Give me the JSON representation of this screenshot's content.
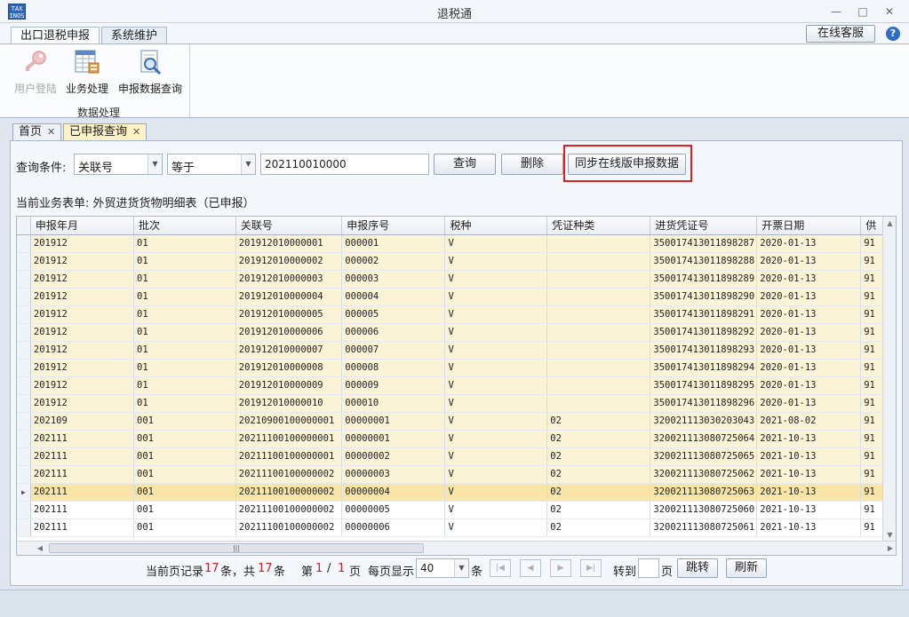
{
  "window": {
    "title": "退税通",
    "icon_text": "TAX\nINOS",
    "min": "—",
    "max": "□",
    "close": "✕"
  },
  "ribbon_tabs": [
    {
      "label": "出口退税申报"
    },
    {
      "label": "系统维护"
    }
  ],
  "support_label": "在线客服",
  "help_label": "?",
  "ribbon": {
    "buttons": [
      {
        "label": "用户登陆"
      },
      {
        "label": "业务处理"
      },
      {
        "label": "申报数据查询"
      }
    ],
    "group_label": "数据处理"
  },
  "doc_tabs": [
    {
      "label": "首页",
      "close": "✕"
    },
    {
      "label": "已申报查询",
      "close": "✕"
    }
  ],
  "query": {
    "label": "查询条件:",
    "field": "关联号",
    "operator": "等于",
    "value": "202110010000",
    "search_btn": "查询",
    "delete_btn": "删除",
    "sync_btn": "同步在线版申报数据"
  },
  "current_table_text": "当前业务表单: 外贸进货货物明细表（已申报）",
  "grid": {
    "columns": [
      "申报年月",
      "批次",
      "关联号",
      "申报序号",
      "税种",
      "凭证种类",
      "进货凭证号",
      "开票日期",
      "供"
    ],
    "rows": [
      [
        "201912",
        "01",
        "201912010000001",
        "000001",
        "V",
        "",
        "35001741301189828​7",
        "2020-01-13",
        "91"
      ],
      [
        "201912",
        "01",
        "201912010000002",
        "000002",
        "V",
        "",
        "350017413011898288",
        "2020-01-13",
        "91"
      ],
      [
        "201912",
        "01",
        "201912010000003",
        "000003",
        "V",
        "",
        "350017413011898289",
        "2020-01-13",
        "91"
      ],
      [
        "201912",
        "01",
        "201912010000004",
        "000004",
        "V",
        "",
        "350017413011898290",
        "2020-01-13",
        "91"
      ],
      [
        "201912",
        "01",
        "201912010000005",
        "000005",
        "V",
        "",
        "350017413011898291",
        "2020-01-13",
        "91"
      ],
      [
        "201912",
        "01",
        "201912010000006",
        "000006",
        "V",
        "",
        "350017413011898292",
        "2020-01-13",
        "91"
      ],
      [
        "201912",
        "01",
        "201912010000007",
        "000007",
        "V",
        "",
        "350017413011898293",
        "2020-01-13",
        "91"
      ],
      [
        "201912",
        "01",
        "201912010000008",
        "000008",
        "V",
        "",
        "350017413011898294",
        "2020-01-13",
        "91"
      ],
      [
        "201912",
        "01",
        "201912010000009",
        "000009",
        "V",
        "",
        "350017413011898295",
        "2020-01-13",
        "91"
      ],
      [
        "201912",
        "01",
        "201912010000010",
        "000010",
        "V",
        "",
        "350017413011898296",
        "2020-01-13",
        "91"
      ],
      [
        "202109",
        "001",
        "20210900100000001",
        "00000001",
        "V",
        "02",
        "320021113030203043",
        "2021-08-02",
        "91"
      ],
      [
        "202111",
        "001",
        "20211100100000001",
        "00000001",
        "V",
        "02",
        "320021113080725064",
        "2021-10-13",
        "91"
      ],
      [
        "202111",
        "001",
        "20211100100000001",
        "00000002",
        "V",
        "02",
        "320021113080725065",
        "2021-10-13",
        "91"
      ],
      [
        "202111",
        "001",
        "20211100100000002",
        "00000003",
        "V",
        "02",
        "320021113080725062",
        "2021-10-13",
        "91"
      ],
      [
        "202111",
        "001",
        "20211100100000002",
        "00000004",
        "V",
        "02",
        "320021113080725063",
        "2021-10-13",
        "91"
      ],
      [
        "202111",
        "001",
        "20211100100000002",
        "00000005",
        "V",
        "02",
        "320021113080725060",
        "2021-10-13",
        "91"
      ],
      [
        "202111",
        "001",
        "20211100100000002",
        "00000006",
        "V",
        "02",
        "320021113080725061",
        "2021-10-13",
        "91"
      ]
    ],
    "selected_row": 14,
    "hscroll_grip": "|||"
  },
  "pager": {
    "page_records_prefix": "当前页记录",
    "page_records": "17",
    "records_unit": "条，共",
    "total": "17",
    "total_unit": "条",
    "page_prefix": "第",
    "page_current": "1",
    "page_sep": "/",
    "page_total": "1",
    "page_unit": "页",
    "per_page_label": "每页显示",
    "per_page_value": "40",
    "per_page_unit": "条",
    "goto_label": "转到",
    "goto_unit": "页",
    "jump_btn": "跳转",
    "refresh_btn": "刷新"
  }
}
